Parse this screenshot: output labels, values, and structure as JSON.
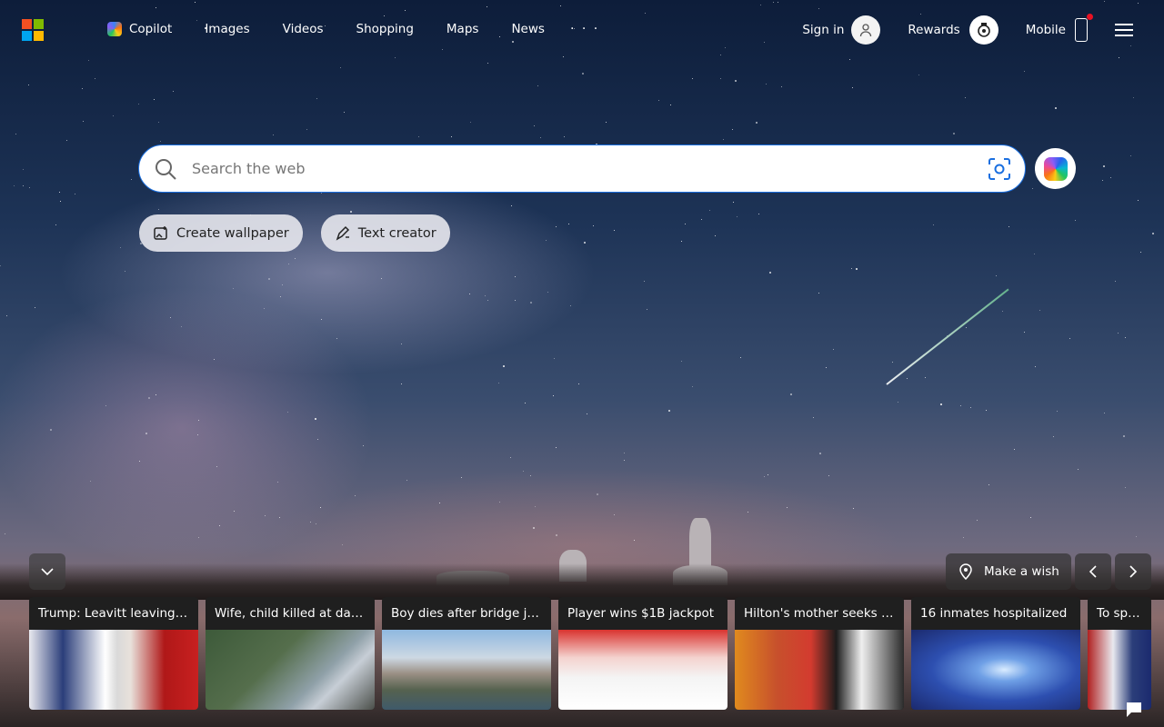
{
  "header": {
    "nav": [
      {
        "label": "Copilot",
        "icon": "copilot-icon"
      },
      {
        "label": "Images"
      },
      {
        "label": "Videos"
      },
      {
        "label": "Shopping"
      },
      {
        "label": "Maps"
      },
      {
        "label": "News"
      }
    ],
    "more_label": "· · ·",
    "sign_in": "Sign in",
    "rewards": "Rewards",
    "mobile": "Mobile",
    "notification_color": "#e81123"
  },
  "search": {
    "placeholder": "Search the web"
  },
  "chips": {
    "create_wallpaper": "Create wallpaper",
    "text_creator": "Text creator"
  },
  "bottom": {
    "make_wish": "Make a wish"
  },
  "news": [
    {
      "title": "Trump: Leavitt leaving ..."
    },
    {
      "title": "Wife, child killed at day..."
    },
    {
      "title": "Boy dies after bridge ju..."
    },
    {
      "title": "Player wins $1B jackpot"
    },
    {
      "title": "Hilton's mother seeks c..."
    },
    {
      "title": "16 inmates hospitalized"
    },
    {
      "title": "To spend"
    }
  ],
  "colors": {
    "accent": "#1a6fe0",
    "ms_red": "#f25022",
    "ms_green": "#7fba00",
    "ms_blue": "#00a4ef",
    "ms_yellow": "#ffb900"
  }
}
